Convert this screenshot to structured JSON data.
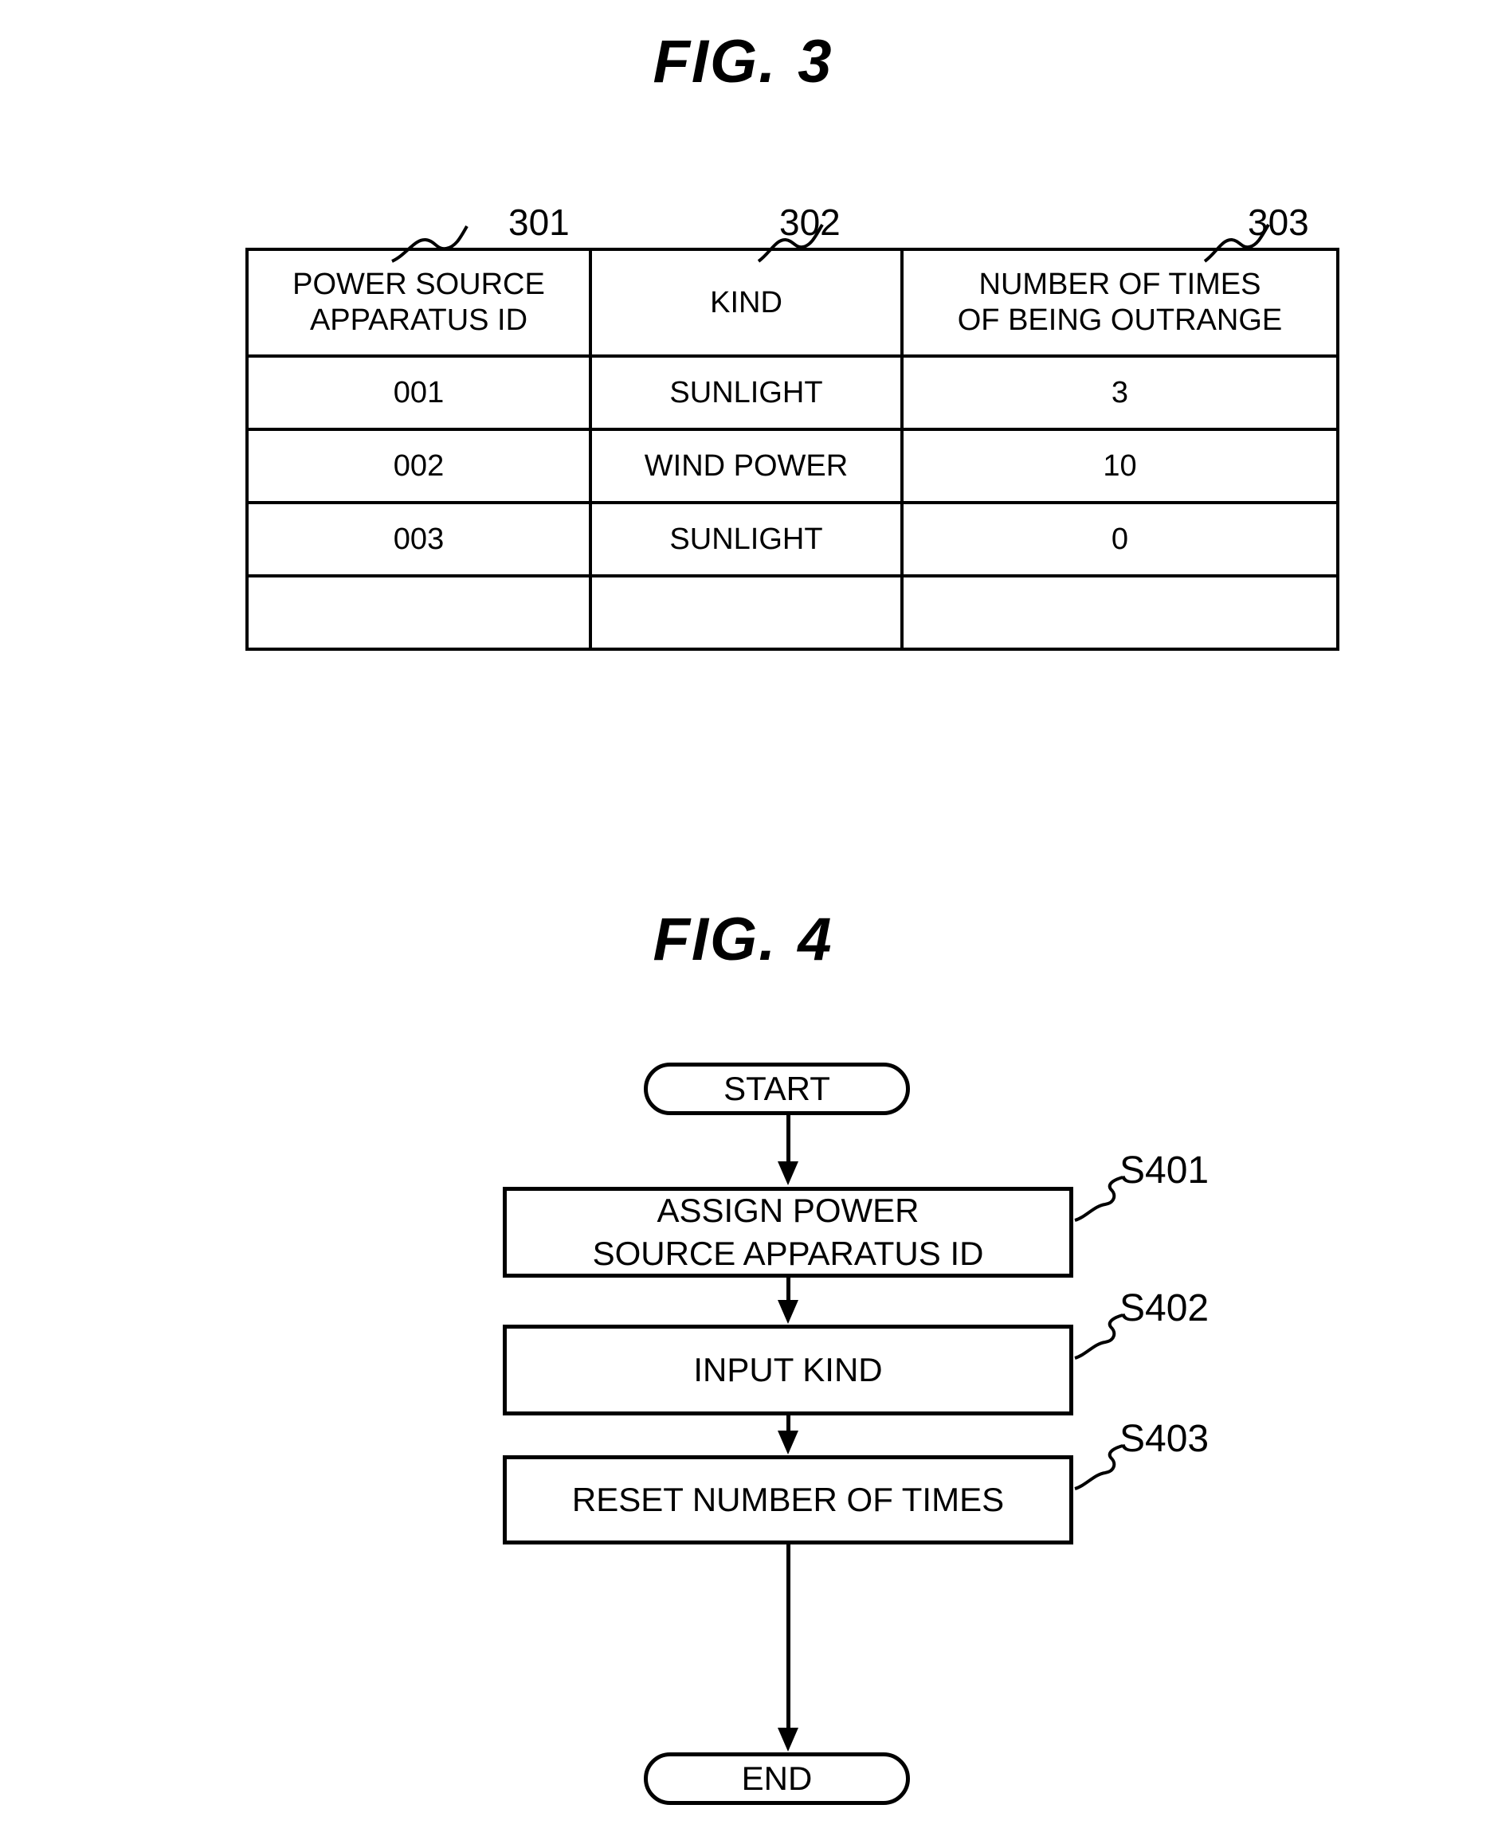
{
  "figures": [
    {
      "id": "fig3",
      "label_word": "FIG.",
      "label_number": "3",
      "table": {
        "headers": [
          {
            "line1": "POWER SOURCE",
            "line2": "APPARATUS ID"
          },
          {
            "line1": "KIND",
            "line2": ""
          },
          {
            "line1": "NUMBER OF TIMES",
            "line2": "OF BEING OUTRANGE"
          }
        ],
        "rows": [
          {
            "id": "001",
            "kind": "SUNLIGHT",
            "count": "3"
          },
          {
            "id": "002",
            "kind": "WIND POWER",
            "count": "10"
          },
          {
            "id": "003",
            "kind": "SUNLIGHT",
            "count": "0"
          },
          {
            "id": "",
            "kind": "",
            "count": ""
          }
        ],
        "reference_numerals": [
          {
            "value": "301",
            "points_to": "POWER SOURCE APPARATUS ID column"
          },
          {
            "value": "302",
            "points_to": "KIND column"
          },
          {
            "value": "303",
            "points_to": "NUMBER OF TIMES OF BEING OUTRANGE column"
          }
        ]
      }
    },
    {
      "id": "fig4",
      "label_word": "FIG.",
      "label_number": "4",
      "flowchart": {
        "start_label": "START",
        "end_label": "END",
        "steps": [
          {
            "ref": "S401",
            "line1": "ASSIGN POWER",
            "line2": "SOURCE APPARATUS ID"
          },
          {
            "ref": "S402",
            "line1": "INPUT KIND",
            "line2": ""
          },
          {
            "ref": "S403",
            "line1": "RESET NUMBER OF TIMES",
            "line2": ""
          }
        ]
      }
    }
  ],
  "colors": {
    "ink": "#000000",
    "paper": "#ffffff"
  }
}
